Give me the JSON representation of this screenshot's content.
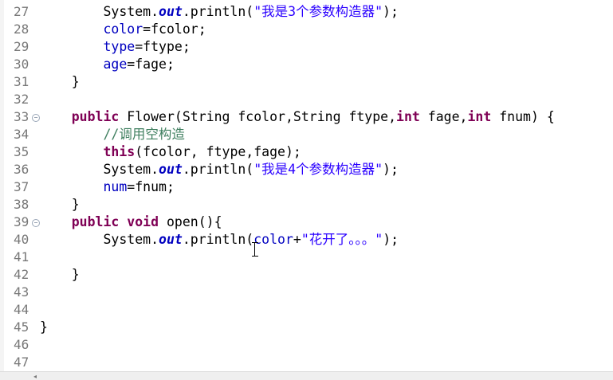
{
  "lines": [
    {
      "n": "27",
      "fold": false,
      "code": [
        {
          "t": "        System."
        },
        {
          "t": "out",
          "c": "st"
        },
        {
          "t": ".println("
        },
        {
          "t": "\"我是3个参数构造器\"",
          "c": "str"
        },
        {
          "t": ");"
        }
      ]
    },
    {
      "n": "28",
      "fold": false,
      "code": [
        {
          "t": "        "
        },
        {
          "t": "color",
          "c": "fld"
        },
        {
          "t": "=fcolor;"
        }
      ]
    },
    {
      "n": "29",
      "fold": false,
      "code": [
        {
          "t": "        "
        },
        {
          "t": "type",
          "c": "fld"
        },
        {
          "t": "=ftype;"
        }
      ]
    },
    {
      "n": "30",
      "fold": false,
      "code": [
        {
          "t": "        "
        },
        {
          "t": "age",
          "c": "fld"
        },
        {
          "t": "=fage;"
        }
      ]
    },
    {
      "n": "31",
      "fold": false,
      "code": [
        {
          "t": "    }"
        }
      ]
    },
    {
      "n": "32",
      "fold": false,
      "code": [
        {
          "t": ""
        }
      ]
    },
    {
      "n": "33",
      "fold": true,
      "code": [
        {
          "t": "    "
        },
        {
          "t": "public",
          "c": "kw"
        },
        {
          "t": " Flower(String fcolor,String ftype,"
        },
        {
          "t": "int",
          "c": "kw"
        },
        {
          "t": " fage,"
        },
        {
          "t": "int",
          "c": "kw"
        },
        {
          "t": " fnum) {"
        }
      ]
    },
    {
      "n": "34",
      "fold": false,
      "code": [
        {
          "t": "        "
        },
        {
          "t": "//调用空构造",
          "c": "cm"
        }
      ]
    },
    {
      "n": "35",
      "fold": false,
      "code": [
        {
          "t": "        "
        },
        {
          "t": "this",
          "c": "kw"
        },
        {
          "t": "(fcolor, ftype,fage);"
        }
      ]
    },
    {
      "n": "36",
      "fold": false,
      "code": [
        {
          "t": "        System."
        },
        {
          "t": "out",
          "c": "st"
        },
        {
          "t": ".println("
        },
        {
          "t": "\"我是4个参数构造器\"",
          "c": "str"
        },
        {
          "t": ");"
        }
      ]
    },
    {
      "n": "37",
      "fold": false,
      "code": [
        {
          "t": "        "
        },
        {
          "t": "num",
          "c": "fld"
        },
        {
          "t": "=fnum;"
        }
      ]
    },
    {
      "n": "38",
      "fold": false,
      "code": [
        {
          "t": "    }"
        }
      ]
    },
    {
      "n": "39",
      "fold": true,
      "code": [
        {
          "t": "    "
        },
        {
          "t": "public",
          "c": "kw"
        },
        {
          "t": " "
        },
        {
          "t": "void",
          "c": "kw"
        },
        {
          "t": " open(){"
        }
      ]
    },
    {
      "n": "40",
      "fold": false,
      "code": [
        {
          "t": "        System."
        },
        {
          "t": "out",
          "c": "st"
        },
        {
          "t": ".println("
        },
        {
          "t": "color",
          "c": "fld"
        },
        {
          "t": "+"
        },
        {
          "t": "\"花开了。。。\"",
          "c": "str"
        },
        {
          "t": ");"
        }
      ]
    },
    {
      "n": "41",
      "fold": false,
      "code": [
        {
          "t": ""
        }
      ]
    },
    {
      "n": "42",
      "fold": false,
      "code": [
        {
          "t": "    }"
        }
      ]
    },
    {
      "n": "43",
      "fold": false,
      "code": [
        {
          "t": ""
        }
      ]
    },
    {
      "n": "44",
      "fold": false,
      "code": [
        {
          "t": ""
        }
      ]
    },
    {
      "n": "45",
      "fold": false,
      "code": [
        {
          "t": "}"
        }
      ]
    },
    {
      "n": "46",
      "fold": false,
      "code": [
        {
          "t": ""
        }
      ]
    },
    {
      "n": "47",
      "fold": false,
      "code": [
        {
          "t": ""
        }
      ]
    }
  ],
  "fold_icon": "collapse-minus-icon",
  "cursor_icon": "text-ibeam-cursor-icon",
  "colors": {
    "keyword": "#7f0055",
    "field": "#0000c0",
    "string": "#2a00ff",
    "comment": "#3f7f5f",
    "line_number": "#787878"
  }
}
